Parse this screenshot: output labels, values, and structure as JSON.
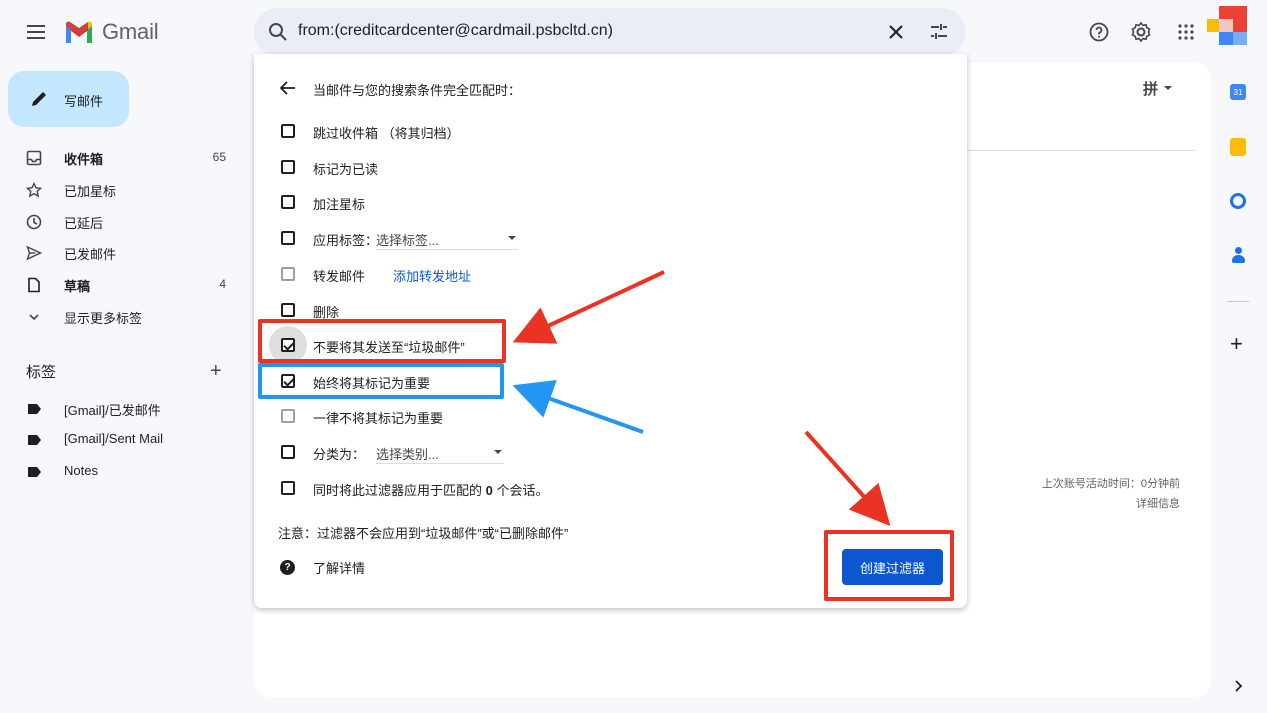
{
  "header": {
    "app_name": "Gmail",
    "search_query": "from:(creditcardcenter@cardmail.psbcltd.cn)"
  },
  "compose": {
    "label": "写邮件"
  },
  "sidebar": {
    "items": [
      {
        "label": "收件箱",
        "count": "65",
        "icon": "inbox-icon"
      },
      {
        "label": "已加星标",
        "count": "",
        "icon": "star-icon"
      },
      {
        "label": "已延后",
        "count": "",
        "icon": "clock-icon"
      },
      {
        "label": "已发邮件",
        "count": "",
        "icon": "send-icon"
      },
      {
        "label": "草稿",
        "count": "4",
        "icon": "draft-icon"
      },
      {
        "label": "显示更多标签",
        "count": "",
        "icon": "chevron-down-icon"
      }
    ],
    "labels_heading": "标签",
    "labels": [
      "[Gmail]/已发邮件",
      "[Gmail]/Sent Mail",
      "Notes"
    ]
  },
  "main": {
    "input_tool": "拼",
    "last_activity": "上次账号活动时间：0分钟前",
    "details_link": "详细信息"
  },
  "filter_panel": {
    "heading": "当邮件与您的搜索条件完全匹配时：",
    "options": [
      {
        "label": "跳过收件箱 （将其归档）",
        "checked": false
      },
      {
        "label": "标记为已读",
        "checked": false
      },
      {
        "label": "加注星标",
        "checked": false
      },
      {
        "label": "应用标签：",
        "checked": false,
        "select": "选择标签..."
      },
      {
        "label": "转发邮件",
        "checked": false,
        "link": "添加转发地址"
      },
      {
        "label": "删除",
        "checked": false
      },
      {
        "label": "不要将其发送至“垃圾邮件”",
        "checked": true
      },
      {
        "label": "始终将其标记为重要",
        "checked": true
      },
      {
        "label": "一律不将其标记为重要",
        "checked": false
      },
      {
        "label": "分类为：",
        "checked": false,
        "select": "选择类别..."
      }
    ],
    "apply_prefix": "同时将此过滤器应用于匹配的 ",
    "apply_count": "0",
    "apply_suffix": " 个会话。",
    "note": "注意：过滤器不会应用到“垃圾邮件”或“已删除邮件”",
    "learn_more": "了解详情",
    "create_button": "创建过滤器"
  },
  "colors": {
    "accent": "#0b57d0",
    "compose_bg": "#c2e7ff",
    "annotation_red": "#ea3323",
    "annotation_blue": "#2196f3"
  }
}
